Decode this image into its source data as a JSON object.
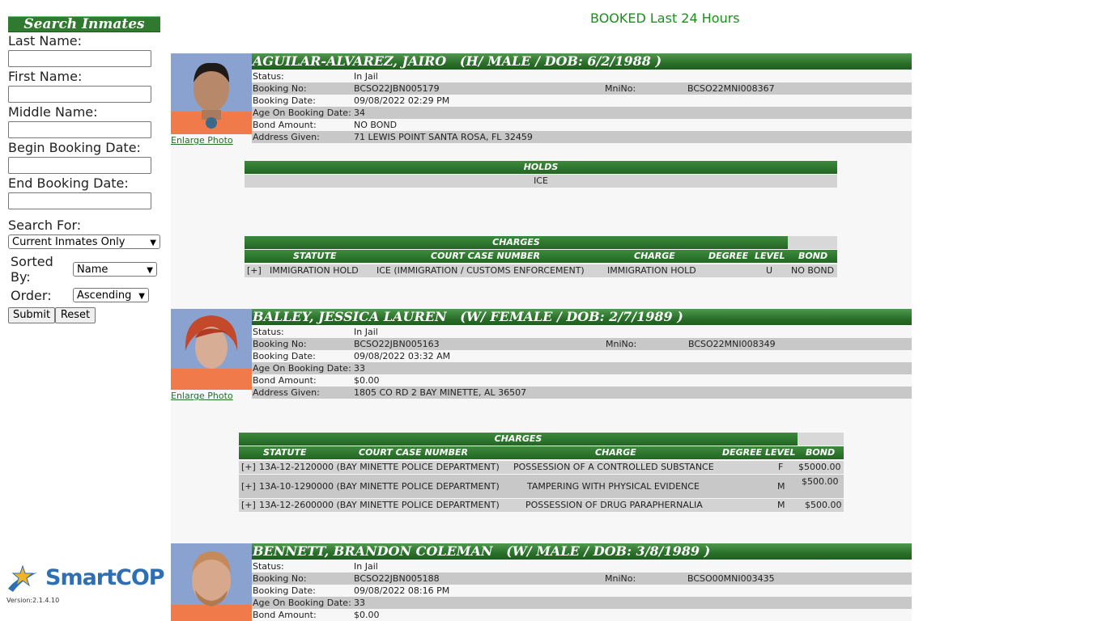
{
  "sidebar": {
    "title": "Search Inmates",
    "last_name_label": "Last Name:",
    "first_name_label": "First Name:",
    "middle_name_label": "Middle Name:",
    "begin_date_label": "Begin Booking Date:",
    "end_date_label": "End Booking Date:",
    "search_for_label": "Search For:",
    "search_for_value": "Current Inmates Only",
    "sorted_by_label_1": "Sorted",
    "sorted_by_label_2": "By:",
    "sorted_by_value": "Name",
    "order_label": "Order:",
    "order_value": "Ascending",
    "submit_label": "Submit",
    "reset_label": "Reset",
    "logo_text": "SmartCOP",
    "version": "Version:2.1.4.10"
  },
  "page_title": "BOOKED Last 24 Hours",
  "labels": {
    "status": "Status:",
    "booking_no": "Booking No:",
    "booking_date": "Booking Date:",
    "age": "Age On Booking Date:",
    "bond": "Bond Amount:",
    "address": "Address Given:",
    "mnino": "MniNo:",
    "enlarge": "Enlarge Photo",
    "holds": "HOLDS",
    "charges": "CHARGES",
    "col_statute": "STATUTE",
    "col_case": "COURT CASE NUMBER",
    "col_charge": "CHARGE",
    "col_degree": "DEGREE",
    "col_level": "LEVEL",
    "col_degree_level": "DEGREE LEVEL",
    "col_bond": "BOND"
  },
  "inmates": [
    {
      "name_line": "AGUILAR-ALVAREZ, JAIRO   (H/ MALE / DOB: 6/2/1988 )",
      "status": "In Jail",
      "booking_no": "BCSO22JBN005179",
      "mnino": "BCSO22MNI008367",
      "booking_date": "09/08/2022 02:29 PM",
      "age": "34",
      "bond": "NO BOND",
      "address": "71 LEWIS POINT SANTA ROSA, FL 32459",
      "holds": [
        "ICE"
      ],
      "charges": [
        {
          "expand": "[+]",
          "statute": "IMMIGRATION HOLD",
          "case": "ICE (IMMIGRATION / CUSTOMS ENFORCEMENT)",
          "charge": "IMMIGRATION HOLD",
          "degree": "",
          "level": "U",
          "bond": "NO BOND"
        }
      ]
    },
    {
      "name_line": "BALLEY, JESSICA LAUREN   (W/ FEMALE / DOB: 2/7/1989 )",
      "status": "In Jail",
      "booking_no": "BCSO22JBN005163",
      "mnino": "BCSO22MNI008349",
      "booking_date": "09/08/2022 03:32 AM",
      "age": "33",
      "bond": "$0.00",
      "address": "1805 CO RD 2 BAY MINETTE, AL 36507",
      "charges": [
        {
          "expand": "[+]",
          "statute": "13A-12-212",
          "case": "0000 (BAY MINETTE POLICE DEPARTMENT)",
          "charge": "POSSESSION OF A CONTROLLED SUBSTANCE",
          "level": "F",
          "bond": "$5000.00"
        },
        {
          "expand": "[+]",
          "statute": "13A-10-129",
          "case": "0000 (BAY MINETTE POLICE DEPARTMENT)",
          "charge": "TAMPERING WITH PHYSICAL EVIDENCE",
          "level": "M",
          "bond": "$500.00"
        },
        {
          "expand": "[+]",
          "statute": "13A-12-260",
          "case": "0000 (BAY MINETTE POLICE DEPARTMENT)",
          "charge": "POSSESSION OF DRUG PARAPHERNALIA",
          "level": "M",
          "bond": "$500.00"
        }
      ]
    },
    {
      "name_line": "BENNETT, BRANDON COLEMAN   (W/ MALE / DOB: 3/8/1989 )",
      "status": "In Jail",
      "booking_no": "BCSO22JBN005188",
      "mnino": "BCSO00MNI003435",
      "booking_date": "09/08/2022 08:16 PM",
      "age": "33",
      "bond": "$0.00"
    }
  ],
  "colors": {
    "brand_green": "#2a6f2a",
    "title_green": "#1a8f1a",
    "row_shade": "#c8c8c8"
  }
}
